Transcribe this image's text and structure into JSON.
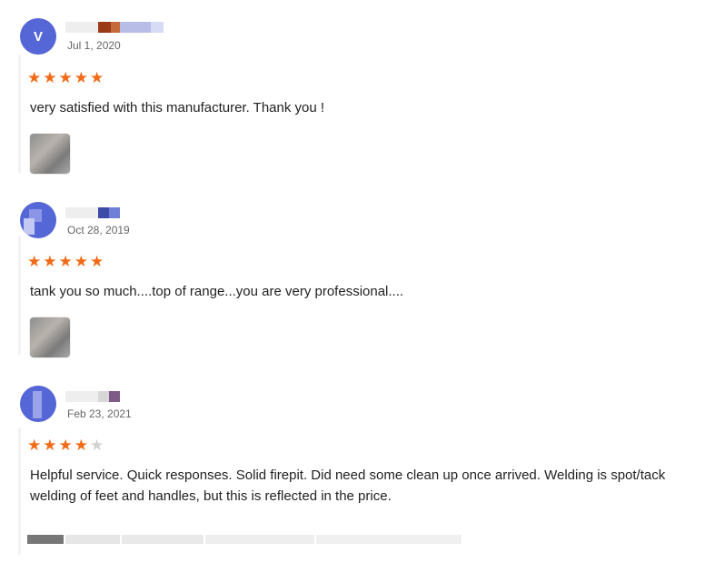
{
  "reviews": [
    {
      "avatar_letter": "V",
      "date": "Jul 1, 2020",
      "rating": 5,
      "text": "very satisfied with this manufacturer. Thank you !",
      "has_photo": true
    },
    {
      "avatar_letter": "",
      "date": "Oct 28, 2019",
      "rating": 5,
      "text": "tank you so much....top of range...you are very professional....",
      "has_photo": true
    },
    {
      "avatar_letter": "",
      "date": "Feb 23, 2021",
      "rating": 4,
      "text": "Helpful service. Quick responses. Solid firepit. Did need some clean up once arrived. Welding is spot/tack welding of feet and handles, but this is reflected in the price.",
      "has_photo": false
    }
  ],
  "colors": {
    "star": "#f26a16",
    "star_empty": "#d0d0d0",
    "avatar": "#5566d6"
  },
  "icons": {
    "star": "star-icon"
  }
}
